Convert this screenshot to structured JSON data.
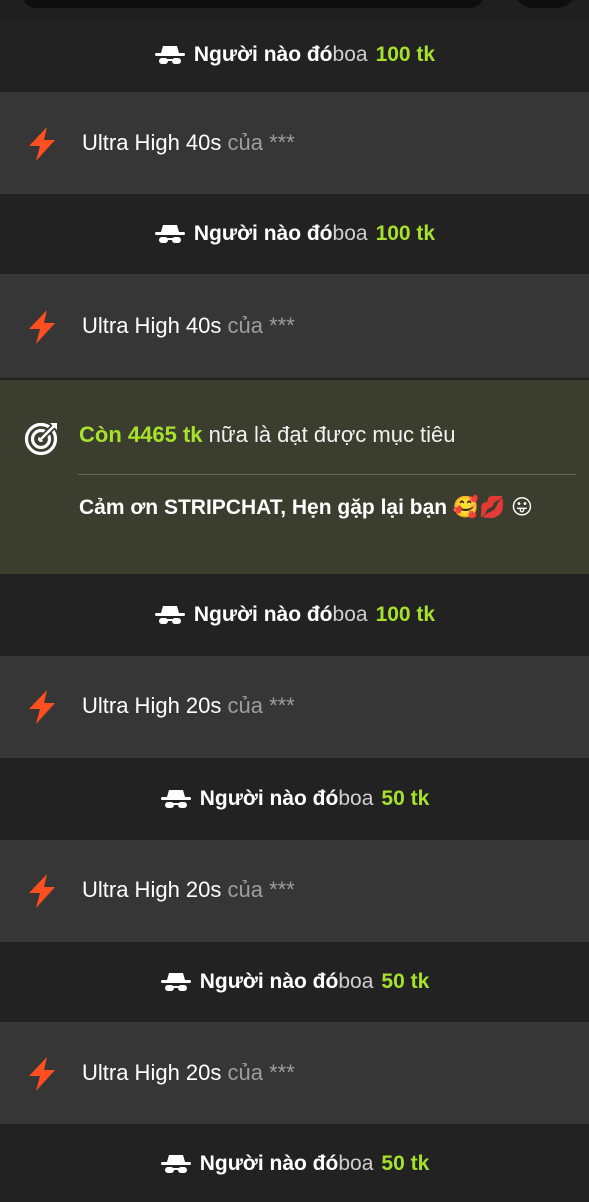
{
  "colors": {
    "tip_bg": "#222222",
    "event_bg": "#363636",
    "goal_bg": "#3b3e2f",
    "amount": "#a6e12b",
    "bolt": "#ff4e1f",
    "muted": "#9d9d9d"
  },
  "icons": {
    "tip": "anonymous-spy-icon",
    "event": "lightning-bolt-icon",
    "goal": "target-goal-icon"
  },
  "feed": [
    {
      "type": "tip",
      "who": "Người nào đó",
      "verb": "boa",
      "amount": "100 tk"
    },
    {
      "type": "event",
      "name": "Ultra High 40s",
      "of": "của",
      "user": "***"
    },
    {
      "type": "tip",
      "who": "Người nào đó",
      "verb": "boa",
      "amount": "100 tk"
    },
    {
      "type": "event",
      "name": "Ultra High 40s",
      "of": "của",
      "user": "***"
    },
    {
      "type": "goal",
      "prefix": "Còn",
      "amount": "4465 tk",
      "suffix": "nữa là đạt được mục tiêu",
      "message": "Cảm ơn STRIPCHAT, Hẹn gặp lại bạn 🥰💋 😛"
    },
    {
      "type": "tip",
      "who": "Người nào đó",
      "verb": "boa",
      "amount": "100 tk"
    },
    {
      "type": "event",
      "name": "Ultra High 20s",
      "of": "của",
      "user": "***"
    },
    {
      "type": "tip",
      "who": "Người nào đó",
      "verb": "boa",
      "amount": "50 tk"
    },
    {
      "type": "event",
      "name": "Ultra High 20s",
      "of": "của",
      "user": "***"
    },
    {
      "type": "tip",
      "who": "Người nào đó",
      "verb": "boa",
      "amount": "50 tk"
    },
    {
      "type": "event",
      "name": "Ultra High 20s",
      "of": "của",
      "user": "***"
    },
    {
      "type": "tip",
      "who": "Người nào đó",
      "verb": "boa",
      "amount": "50 tk"
    }
  ]
}
